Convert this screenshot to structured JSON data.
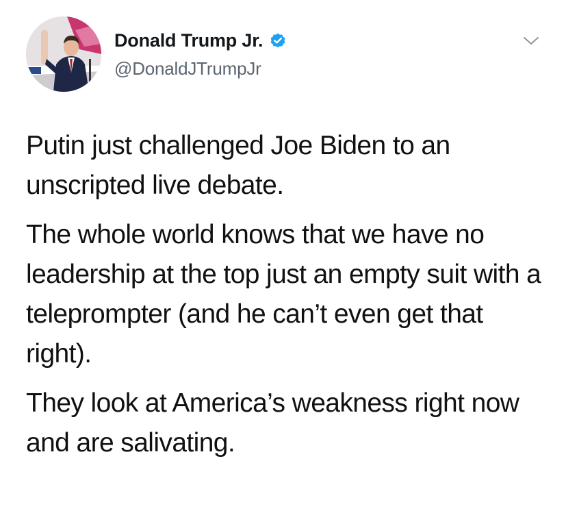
{
  "tweet": {
    "display_name": "Donald Trump Jr.",
    "handle": "@DonaldJTrumpJr",
    "verified": true,
    "paragraphs": [
      "Putin just challenged Joe Biden to an unscripted live debate.",
      "The whole world knows that we have no leadership at the top just an empty suit with a teleprompter (and he can’t even get that right).",
      "They look at America’s weakness right now and are salivating."
    ]
  },
  "icons": {
    "avatar": "profile-photo",
    "verified": "verified-badge-icon",
    "menu": "chevron-down-icon"
  },
  "colors": {
    "verified_blue": "#1da1f2",
    "handle_gray": "#5b6670",
    "text": "#111111"
  }
}
